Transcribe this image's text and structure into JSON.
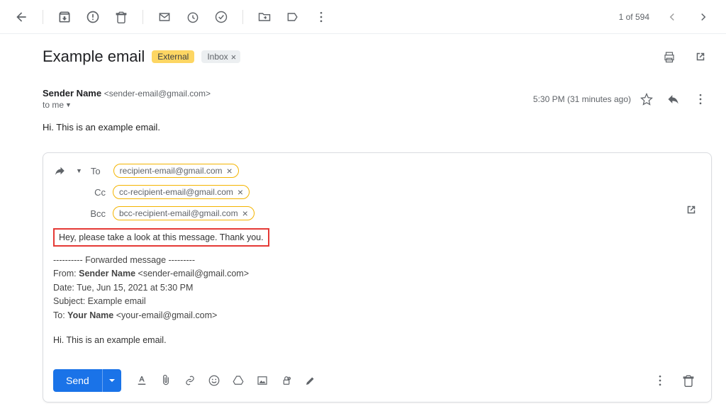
{
  "toolbar": {
    "count": "1 of 594"
  },
  "header": {
    "subject": "Example email",
    "badge_external": "External",
    "badge_inbox": "Inbox"
  },
  "message": {
    "from_name": "Sender Name",
    "from_email": "<sender-email@gmail.com>",
    "to_short": "to me",
    "timestamp": "5:30 PM (31 minutes ago)",
    "body": "Hi. This is an example email."
  },
  "reply": {
    "labels": {
      "to": "To",
      "cc": "Cc",
      "bcc": "Bcc"
    },
    "to_chip": "recipient-email@gmail.com",
    "cc_chip": "cc-recipient-email@gmail.com",
    "bcc_chip": "bcc-recipient-email@gmail.com",
    "annotation": "Hey, please take a look at this message. Thank you.",
    "forward": {
      "divider": "---------- Forwarded message ---------",
      "from_label": "From:",
      "from_name": "Sender Name",
      "from_email": "<sender-email@gmail.com>",
      "date_label": "Date:",
      "date_value": "Tue, Jun 15, 2021 at 5:30 PM",
      "subject_label": "Subject:",
      "subject_value": "Example email",
      "to_label": "To:",
      "to_name": "Your Name",
      "to_email": "<your-email@gmail.com>",
      "body": "Hi. This is an example email."
    },
    "send_label": "Send"
  }
}
